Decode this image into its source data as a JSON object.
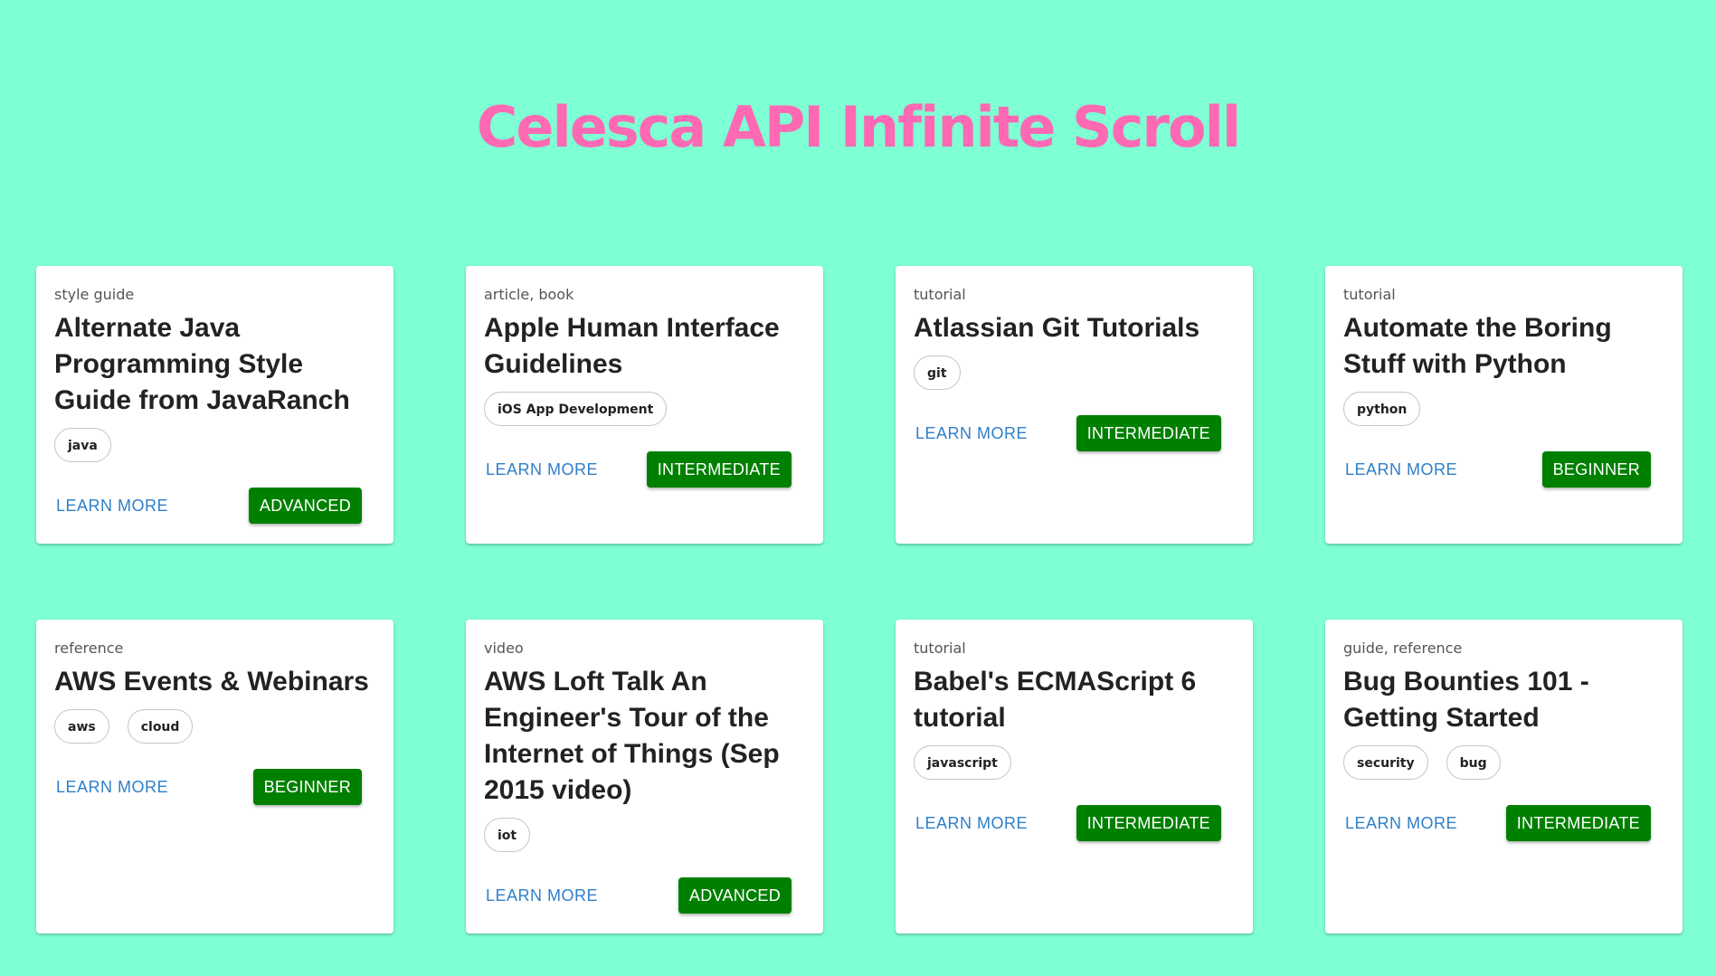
{
  "header": {
    "title": "Celesca API Infinite Scroll"
  },
  "learn_more_label": "LEARN MORE",
  "cards": [
    {
      "type": "style guide",
      "title": "Alternate Java Programming Style Guide from JavaRanch",
      "tags": [
        "java"
      ],
      "level": "ADVANCED"
    },
    {
      "type": "article, book",
      "title": "Apple Human Interface Guidelines",
      "tags": [
        "iOS App Development"
      ],
      "level": "INTERMEDIATE"
    },
    {
      "type": "tutorial",
      "title": "Atlassian Git Tutorials",
      "tags": [
        "git"
      ],
      "level": "INTERMEDIATE"
    },
    {
      "type": "tutorial",
      "title": "Automate the Boring Stuff with Python",
      "tags": [
        "python"
      ],
      "level": "BEGINNER"
    },
    {
      "type": "reference",
      "title": "AWS Events & Webinars",
      "tags": [
        "aws",
        "cloud"
      ],
      "level": "BEGINNER"
    },
    {
      "type": "video",
      "title": "AWS Loft Talk An Engineer's Tour of the Internet of Things (Sep 2015 video)",
      "tags": [
        "iot"
      ],
      "level": "ADVANCED"
    },
    {
      "type": "tutorial",
      "title": "Babel's ECMAScript 6 tutorial",
      "tags": [
        "javascript"
      ],
      "level": "INTERMEDIATE"
    },
    {
      "type": "guide, reference",
      "title": "Bug Bounties 101 - Getting Started",
      "tags": [
        "security",
        "bug"
      ],
      "level": "INTERMEDIATE"
    }
  ],
  "colors": {
    "background": "#7fffd4",
    "title": "#ff69b4",
    "level_button": "#008000",
    "link": "#2f7fc8"
  }
}
